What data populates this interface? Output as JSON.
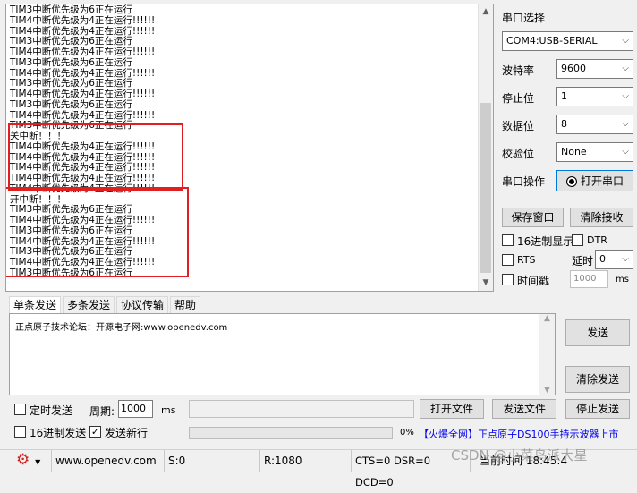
{
  "receive": {
    "lines": [
      "TIM3中断优先级为6正在运行",
      "TIM4中断优先级为4正在运行!!!!!!",
      "TIM4中断优先级为4正在运行!!!!!!",
      "TIM3中断优先级为6正在运行",
      "TIM4中断优先级为4正在运行!!!!!!",
      "TIM3中断优先级为6正在运行",
      "TIM4中断优先级为4正在运行!!!!!!",
      "TIM3中断优先级为6正在运行",
      "TIM4中断优先级为4正在运行!!!!!!",
      "TIM3中断优先级为6正在运行",
      "TIM4中断优先级为4正在运行!!!!!!",
      "TIM3中断优先级为6正在运行",
      "关中断！！！",
      "TIM4中断优先级为4正在运行!!!!!!",
      "TIM4中断优先级为4正在运行!!!!!!",
      "TIM4中断优先级为4正在运行!!!!!!",
      "TIM4中断优先级为4正在运行!!!!!!",
      "TIM4中断优先级为4正在运行!!!!!!",
      "开中断！！！",
      "TIM3中断优先级为6正在运行",
      "TIM4中断优先级为4正在运行!!!!!!",
      "TIM3中断优先级为6正在运行",
      "TIM4中断优先级为4正在运行!!!!!!",
      "TIM3中断优先级为6正在运行",
      "TIM4中断优先级为4正在运行!!!!!!",
      "TIM3中断优先级为6正在运行"
    ]
  },
  "settings": {
    "port_select_label": "串口选择",
    "port_value": "COM4:USB-SERIAL",
    "baud_label": "波特率",
    "baud_value": "9600",
    "stopbits_label": "停止位",
    "stopbits_value": "1",
    "databits_label": "数据位",
    "databits_value": "8",
    "parity_label": "校验位",
    "parity_value": "None",
    "port_op_label": "串口操作",
    "open_port_button": "打开串口",
    "save_window_button": "保存窗口",
    "clear_recv_button": "清除接收",
    "hex_display_label": "16进制显示",
    "dtr_label": "DTR",
    "rts_label": "RTS",
    "timed_label": "延时",
    "timed_value": "0",
    "timestamp_label": "时间戳",
    "timestamp_value": "1000",
    "ms_label": "ms"
  },
  "tabs": [
    "单条发送",
    "多条发送",
    "协议传输",
    "帮助"
  ],
  "send": {
    "text": "正点原子技术论坛：开源电子网:www.openedv.com",
    "send_button": "发送",
    "clear_send_button": "清除发送"
  },
  "bottom": {
    "timed_send_label": "定时发送",
    "period_label": "周期:",
    "period_value": "1000",
    "ms_label": "ms",
    "open_file_button": "打开文件",
    "send_file_button": "发送文件",
    "stop_send_button": "停止发送",
    "hex_send_label": "16进制发送",
    "send_newline_label": "发送新行",
    "send_newline_checked": true,
    "progress_text": "0%",
    "progress_value": 0,
    "ad_text": "【火爆全网】正点原子DS100手持示波器上市"
  },
  "status": {
    "url": "www.openedv.com",
    "sent": "S:0",
    "received": "R:1080",
    "lines": "CTS=0 DSR=0 DCD=0",
    "time": "当前时间 18:45:4"
  },
  "watermark": "CSDN @小菜鸟派大星",
  "colors": {
    "highlight": "#e02020",
    "link_blue": "#0000ee",
    "ad_red": "#d40000"
  }
}
